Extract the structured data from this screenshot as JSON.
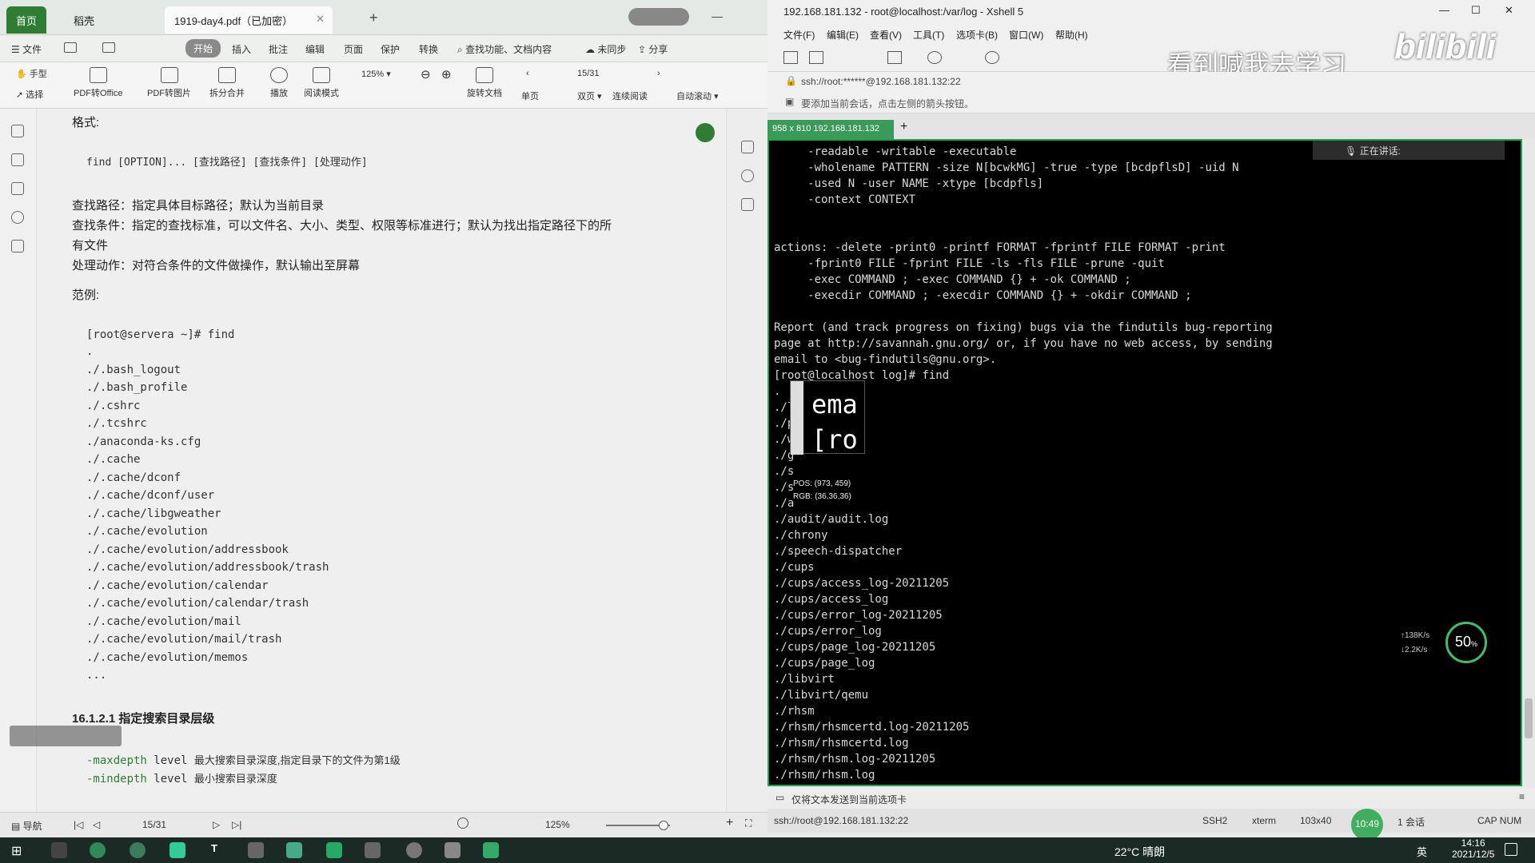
{
  "pdf": {
    "tabs": {
      "home": "首页",
      "docer": "稻壳",
      "file": "1919-day4.pdf（已加密）"
    },
    "menu": [
      "文件",
      "开始",
      "插入",
      "批注",
      "编辑",
      "页面",
      "保护",
      "转换"
    ],
    "menu_search": "查找功能、文档内容",
    "menu_right": {
      "sync": "未同步",
      "share": "分享"
    },
    "toolbar": {
      "hand": "手型",
      "select": "选择",
      "to_office": "PDF转Office",
      "to_image": "PDF转图片",
      "split": "拆分合并",
      "play": "播放",
      "read": "阅读模式",
      "zoom": "125%",
      "page": "15/31",
      "rotate": "旋转文档",
      "single": "单页",
      "double": "双页",
      "continuous": "连续阅读",
      "autoscroll": "自动滚动"
    },
    "content": {
      "format_heading": "格式:",
      "syntax": "find [OPTION]... [查找路径] [查找条件] [处理动作]",
      "path_desc": "查找路径：指定具体目标路径；默认为当前目录",
      "cond_desc": "查找条件：指定的查找标准，可以文件名、大小、类型、权限等标准进行；默认为找出指定路径下的所",
      "cond_desc2": "有文件",
      "action_desc": "处理动作：对符合条件的文件做操作，默认输出至屏幕",
      "example_heading": "范例:",
      "prompt": "[root@servera ~]# find",
      "output": [
        ".",
        "./.bash_logout",
        "./.bash_profile",
        "./.cshrc",
        "./.tcshrc",
        "./anaconda-ks.cfg",
        "./.cache",
        "./.cache/dconf",
        "./.cache/dconf/user",
        "./.cache/libgweather",
        "./.cache/evolution",
        "./.cache/evolution/addressbook",
        "./.cache/evolution/addressbook/trash",
        "./.cache/evolution/calendar",
        "./.cache/evolution/calendar/trash",
        "./.cache/evolution/mail",
        "./.cache/evolution/mail/trash",
        "./.cache/evolution/memos",
        "..."
      ],
      "section_heading": "16.1.2.1 指定搜索目录层级",
      "maxdepth": {
        "opt": "-maxdepth",
        "arg": "level",
        "desc": "最大搜索目录深度,指定目录下的文件为第1级"
      },
      "mindepth": {
        "opt": "-mindepth",
        "arg": "level",
        "desc": "最小搜索目录深度"
      }
    },
    "status": {
      "nav": "导航",
      "page": "15/31",
      "zoom": "125%"
    }
  },
  "xshell": {
    "title": "192.168.181.132 - root@localhost:/var/log - Xshell 5",
    "menu": [
      "文件(F)",
      "编辑(E)",
      "查看(V)",
      "工具(T)",
      "选项卡(B)",
      "窗口(W)",
      "帮助(H)"
    ],
    "watermark": "看到喊我去学习",
    "bili": "bilibili",
    "address": "ssh://root:******@192.168.181.132:22",
    "hint": "要添加当前会话，点击左侧的箭头按钮。",
    "size_badge": "958 x 810",
    "tab": "192.168.181.132",
    "speaking": "正在讲话:",
    "terminal": [
      "     -readable -writable -executable",
      "     -wholename PATTERN -size N[bcwkMG] -true -type [bcdpflsD] -uid N",
      "     -used N -user NAME -xtype [bcdpfls]",
      "     -context CONTEXT",
      "",
      "",
      "actions: -delete -print0 -printf FORMAT -fprintf FILE FORMAT -print",
      "     -fprint0 FILE -fprint FILE -ls -fls FILE -prune -quit",
      "     -exec COMMAND ; -exec COMMAND {} + -ok COMMAND ;",
      "     -execdir COMMAND ; -execdir COMMAND {} + -okdir COMMAND ;",
      "",
      "Report (and track progress on fixing) bugs via the findutils bug-reporting",
      "page at http://savannah.gnu.org/ or, if you have no web access, by sending",
      "email to <bug-findutils@gnu.org>.",
      "[root@localhost log]# find",
      ".",
      "./l",
      "./p",
      "./w",
      "./g",
      "./s",
      "./s",
      "./a",
      "./audit/audit.log",
      "./chrony",
      "./speech-dispatcher",
      "./cups",
      "./cups/access_log-20211205",
      "./cups/access_log",
      "./cups/error_log-20211205",
      "./cups/error_log",
      "./cups/page_log-20211205",
      "./cups/page_log",
      "./libvirt",
      "./libvirt/qemu",
      "./rhsm",
      "./rhsm/rhsmcertd.log-20211205",
      "./rhsm/rhsmcertd.log",
      "./rhsm/rhsm.log-20211205",
      "./rhsm/rhsm.log"
    ],
    "magnifier": {
      "line1": "ema",
      "line2": "[ro",
      "pos": "POS: (973, 459)",
      "rgb": "RGB: (36,36,36)"
    },
    "net": {
      "up": "138K/s",
      "down": "2.2K/s",
      "percent": "50",
      "unit": "%"
    },
    "send_bar": "仅将文本发送到当前选项卡",
    "status": {
      "addr": "ssh://root@192.168.181.132:22",
      "proto": "SSH2",
      "term": "xterm",
      "size": "103x40",
      "sessions": "1 会话",
      "caps": "CAP NUM",
      "time_badge": "10:49"
    }
  },
  "taskbar": {
    "weather": "22°C 晴朗",
    "lang": "英",
    "time": "14:16",
    "date": "2021/12/5"
  },
  "colors": {
    "accent": "#2e7d32",
    "terminal_bg": "#000000",
    "terminal_border": "#19a64a",
    "taskbar": "#1c2a25"
  }
}
